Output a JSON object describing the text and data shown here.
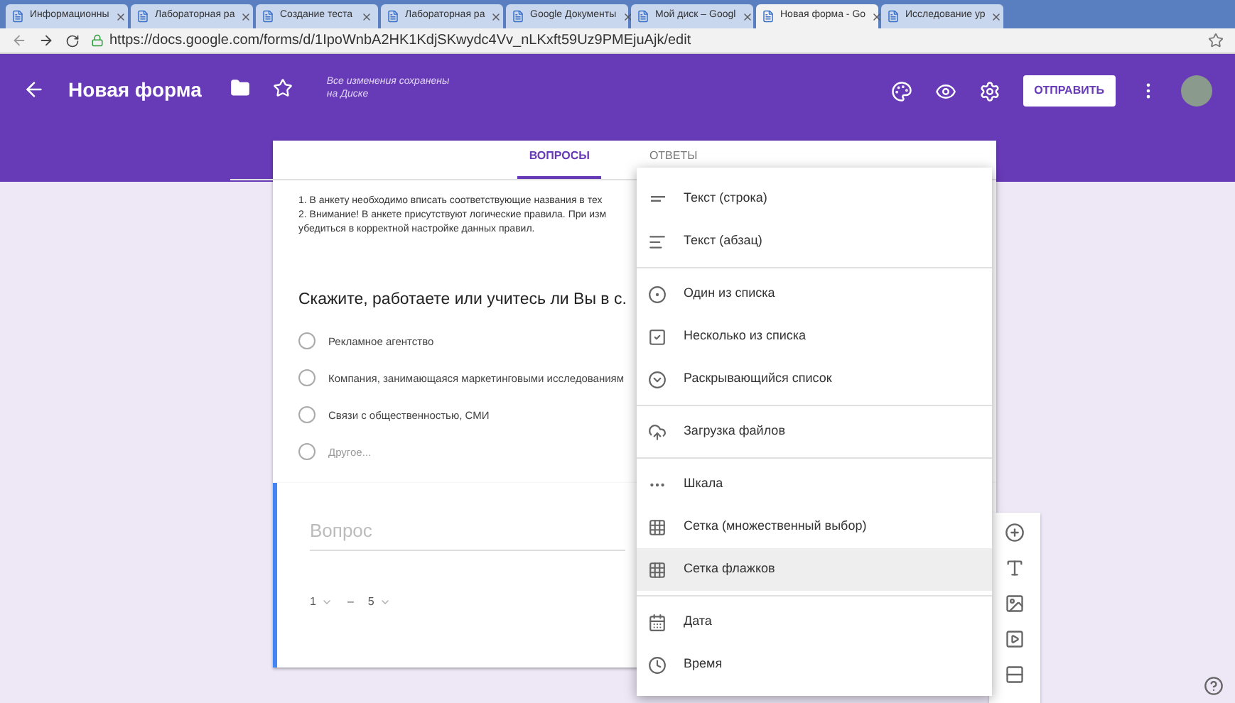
{
  "browser": {
    "tabs": [
      {
        "label": "Информационны",
        "selected": false
      },
      {
        "label": "Лабораторная ра",
        "selected": false
      },
      {
        "label": "Создание теста",
        "selected": false
      },
      {
        "label": "Лабораторная ра",
        "selected": false
      },
      {
        "label": "Google Документы",
        "selected": false
      },
      {
        "label": "Мой диск – Googl",
        "selected": false
      },
      {
        "label": "Новая форма - Go",
        "selected": true
      },
      {
        "label": "Исследование ур",
        "selected": false
      }
    ],
    "url": "https://docs.google.com/forms/d/1IpoWnbA2HK1KdjSKwydc4Vv_nLKxft59Uz9PMEjuAjk/edit"
  },
  "header": {
    "title": "Новая форма",
    "save_status": "Все изменения сохранены на Диске",
    "send_button": "ОТПРАВИТЬ"
  },
  "form_tabs": [
    {
      "label": "ВОПРОСЫ",
      "selected": true
    },
    {
      "label": "ОТВЕТЫ",
      "selected": false
    }
  ],
  "description": [
    "1. В анкету необходимо вписать соответствующие названия в тех",
    "2. Внимание! В анкете присутствуют логические правила. При изм",
    "убедиться в корректной настройке данных правил."
  ],
  "question": {
    "title": "Скажите, работаете или учитесь ли Вы в с.",
    "options": [
      {
        "label": "Рекламное агентство",
        "selected": false
      },
      {
        "label": "Компания, занимающаяся маркетинговыми исследованиям",
        "selected": false
      },
      {
        "label": "Связи с общественностью, СМИ",
        "selected": false
      }
    ],
    "other_option": {
      "label": "Другое...",
      "selected": false
    }
  },
  "new_question": {
    "placeholder": "Вопрос",
    "scale_from": "1",
    "dash": "–",
    "scale_to": "5"
  },
  "menu": [
    [
      {
        "kind": "short-text",
        "label": "Текст (строка)",
        "selected": false
      },
      {
        "kind": "paragraph",
        "label": "Текст (абзац)",
        "selected": false
      }
    ],
    [
      {
        "kind": "radio",
        "label": "Один из списка",
        "selected": false
      },
      {
        "kind": "checkbox",
        "label": "Несколько из списка",
        "selected": false
      },
      {
        "kind": "dropdown",
        "label": "Раскрывающийся список",
        "selected": false
      }
    ],
    [
      {
        "kind": "upload",
        "label": "Загрузка файлов",
        "selected": false
      }
    ],
    [
      {
        "kind": "scale",
        "label": "Шкала",
        "selected": false
      },
      {
        "kind": "grid",
        "label": "Сетка (множественный выбор)",
        "selected": false
      },
      {
        "kind": "grid",
        "label": "Сетка флажков",
        "selected": true
      }
    ],
    [
      {
        "kind": "date",
        "label": "Дата",
        "selected": false
      },
      {
        "kind": "time",
        "label": "Время",
        "selected": false
      }
    ]
  ]
}
